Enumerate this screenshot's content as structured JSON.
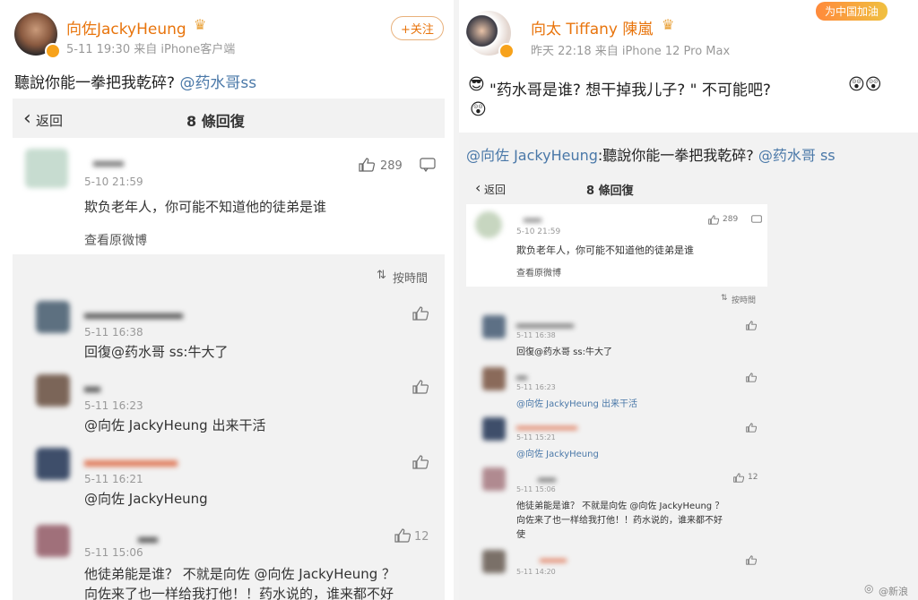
{
  "left": {
    "username": "向佐JackyHeung",
    "time_source": "5-11 19:30  来自 iPhone客户端",
    "follow": "+关注",
    "post": "聽說你能一拳把我乾碎? ",
    "post_mention": "@药水哥ss",
    "nav_back": "返回",
    "nav_title": "8 條回復",
    "top_comment": {
      "time": "5-10 21:59",
      "likes": "289",
      "text": "欺负老年人，你可能不知道他的徒弟是谁",
      "view": "查看原微博"
    },
    "sort": "按時間",
    "replies": [
      {
        "time": "5-11 16:38",
        "text": "回復@药水哥 ss:牛大了",
        "likes": ""
      },
      {
        "time": "5-11 16:23",
        "text": "@向佐 JackyHeung  出来干活",
        "likes": ""
      },
      {
        "time": "5-11 16:21",
        "text": "@向佐 JackyHeung",
        "likes": ""
      },
      {
        "time": "5-11 15:06",
        "text": "他徒弟能是谁？ 不就是向佐 @向佐 JackyHeung ？",
        "text2": "向佐来了也一样给我打他！！药水说的，谁来都不好",
        "likes": "12"
      }
    ]
  },
  "right": {
    "username": "向太 Tiffany 陳嵐",
    "time_source": "昨天 22:18  来自 iPhone 12 Pro Max",
    "badge": "为中国加油",
    "post": "\"药水哥是谁? 想干掉我儿子? \"  不可能吧?",
    "quote_author": "@向佐 JackyHeung",
    "quote_text": ":聽說你能一拳把我乾碎? ",
    "quote_mention": "@药水哥 ss",
    "nav_back": "返回",
    "nav_title": "8 條回復",
    "top_comment": {
      "time": "5-10 21:59",
      "likes": "289",
      "text": "欺负老年人，你可能不知道他的徒弟是谁",
      "view": "查看原微博"
    },
    "sort": "按時間",
    "replies": [
      {
        "time": "5-11 16:38",
        "text": "回復@药水哥 ss:牛大了",
        "likes": ""
      },
      {
        "time": "5-11 16:23",
        "text": "@向佐 JackyHeung  出来干活",
        "likes": ""
      },
      {
        "time": "5-11 15:21",
        "text": "@向佐 JackyHeung",
        "likes": ""
      },
      {
        "time": "5-11 15:06",
        "text": "他徒弟能是谁？ 不就是向佐 @向佐 JackyHeung ？",
        "text2": "向佐来了也一样给我打他！！药水说的，谁来都不好",
        "text3": "使",
        "likes": "12"
      },
      {
        "time": "5-11 14:20",
        "text": "",
        "likes": ""
      }
    ],
    "watermark": "@新浪"
  }
}
